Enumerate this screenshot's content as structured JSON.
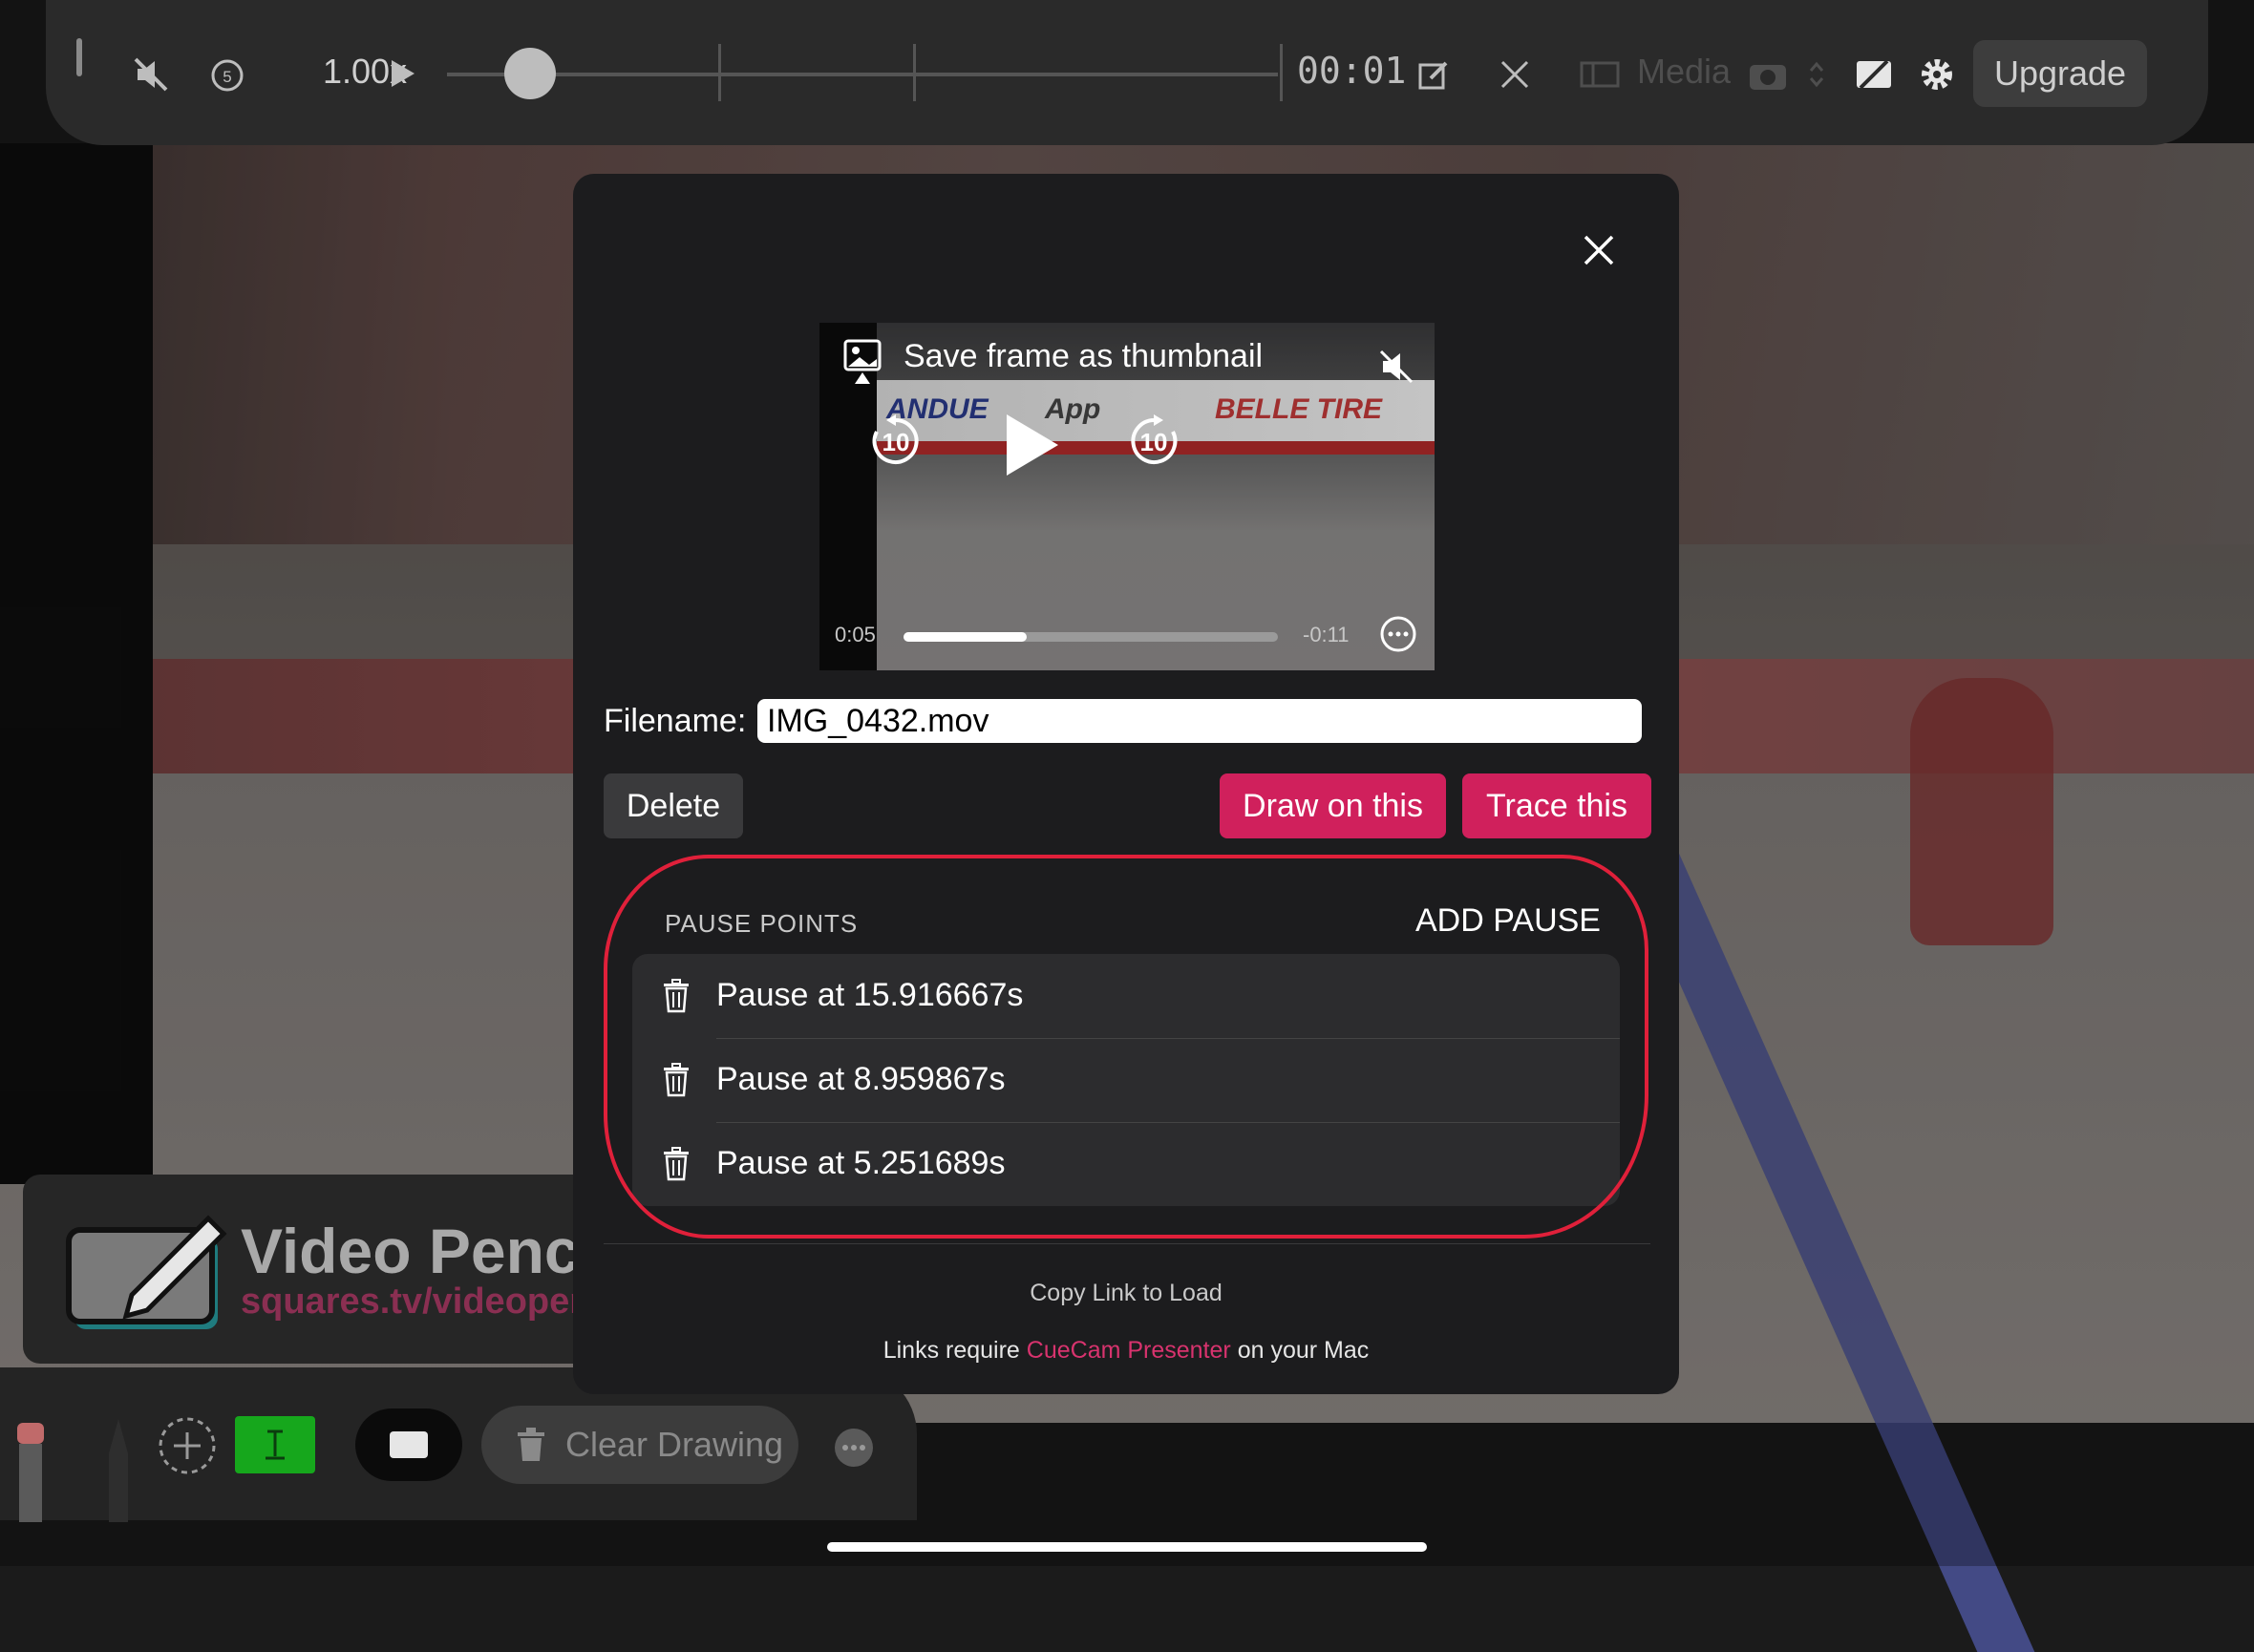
{
  "toolbar": {
    "speed": "1.00x",
    "timecode": "00:01",
    "media_label": "Media",
    "upgrade_label": "Upgrade"
  },
  "modal": {
    "video": {
      "thumbnail_label": "Save  frame as thumbnail",
      "elapsed": "0:05",
      "remaining": "-0:11",
      "progress": 0.33,
      "skip_seconds": "10",
      "ads": [
        "ANDUE",
        "App",
        "BELLE TIRE"
      ]
    },
    "filename_label": "Filename:",
    "filename_value": "IMG_0432.mov",
    "delete_label": "Delete",
    "draw_label": "Draw on this",
    "trace_label": "Trace this",
    "pause_points": {
      "header": "PAUSE POINTS",
      "add_label": "ADD PAUSE",
      "items": [
        {
          "label": "Pause at 15.916667s"
        },
        {
          "label": "Pause at 8.959867s"
        },
        {
          "label": "Pause at 5.251689s"
        }
      ]
    },
    "copy_link_label": "Copy Link to Load",
    "links_require_prefix": "Links require ",
    "links_require_app": "CueCam Presenter",
    "links_require_suffix": " on your Mac"
  },
  "promo": {
    "title": "Video Penc",
    "url": "squares.tv/videopen"
  },
  "bottom_toolbar": {
    "clear_label": "Clear Drawing"
  },
  "colors": {
    "accent": "#d0205c",
    "annotation": "#e0203a",
    "green": "#16a71c"
  }
}
